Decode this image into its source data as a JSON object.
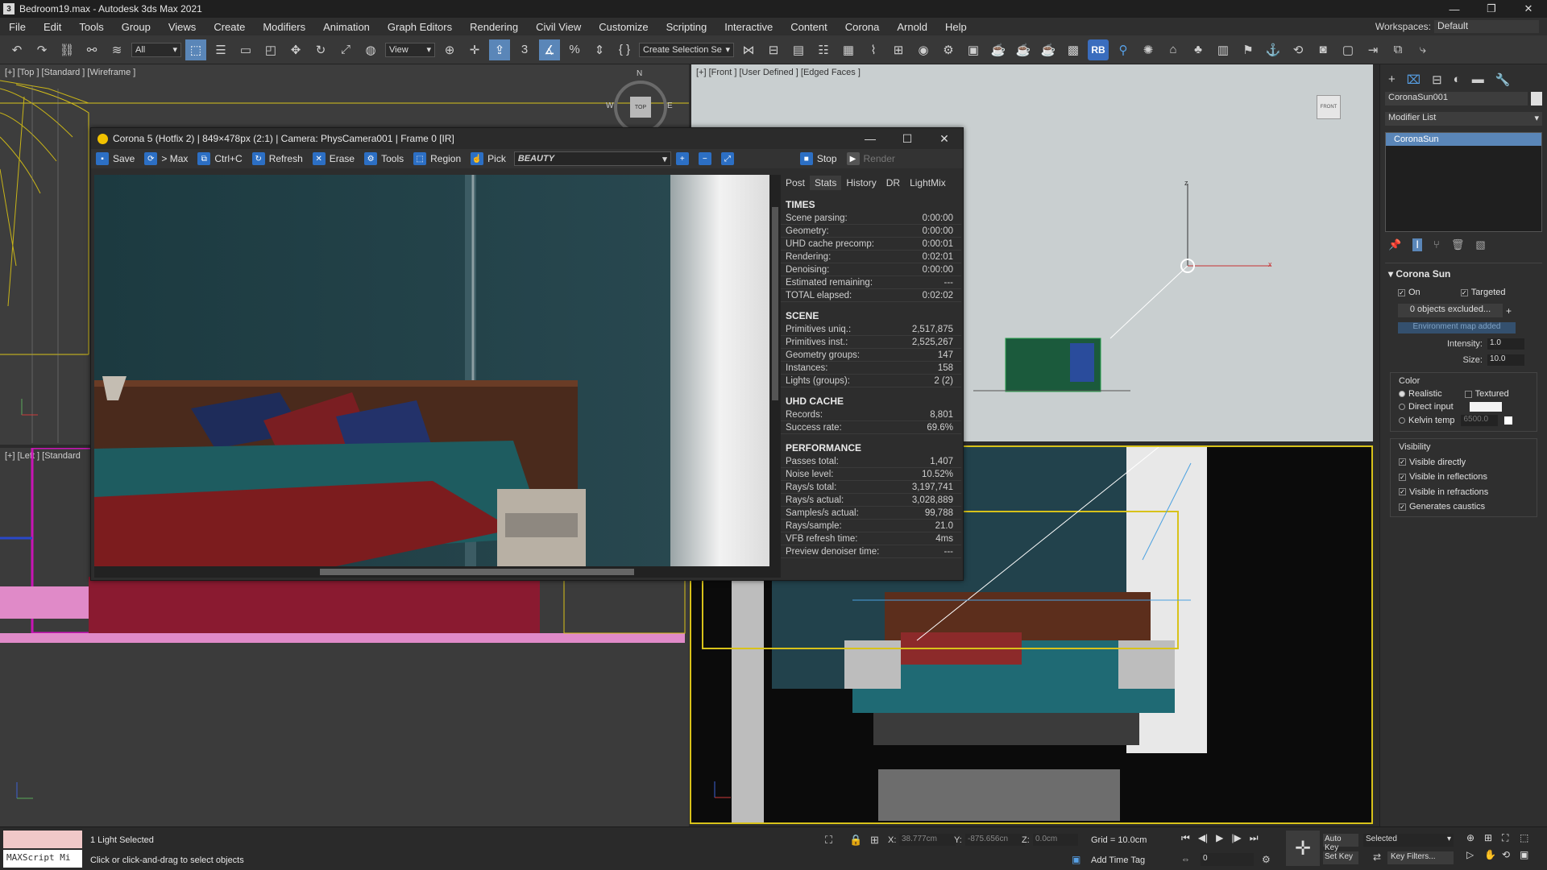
{
  "window": {
    "title": "Bedroom19.max - Autodesk 3ds Max 2021",
    "app_icon": "3",
    "min": "—",
    "max": "❐",
    "close": "✕"
  },
  "menu": {
    "items": [
      "File",
      "Edit",
      "Tools",
      "Group",
      "Views",
      "Create",
      "Modifiers",
      "Animation",
      "Graph Editors",
      "Rendering",
      "Civil View",
      "Customize",
      "Scripting",
      "Interactive",
      "Content",
      "Corona",
      "Arnold",
      "Help"
    ],
    "workspace_label": "Workspaces:",
    "workspace_value": "Default"
  },
  "toolbar": {
    "filter_value": "All",
    "refcoord_value": "View",
    "named_selection": "Create Selection Se",
    "rb_label": "RB"
  },
  "viewports": {
    "top": "[+] [Top ] [Standard ] [Wireframe ]",
    "front": "[+] [Front ] [User Defined ] [Edged Faces ]",
    "left": "[+] [Left ] [Standard",
    "front_cube": "FRONT",
    "top_cube": "TOP",
    "compass_n": "N",
    "compass_w": "W",
    "compass_e": "E",
    "axis_z": "z",
    "axis_x": "x"
  },
  "vfb": {
    "title": "Corona 5 (Hotfix 2) | 849×478px (2:1) | Camera: PhysCamera001 | Frame 0 [IR]",
    "buttons": {
      "save": "Save",
      "tomax": "> Max",
      "ctrlc": "Ctrl+C",
      "refresh": "Refresh",
      "erase": "Erase",
      "tools": "Tools",
      "region": "Region",
      "pick": "Pick",
      "stop": "Stop",
      "render": "Render"
    },
    "channel": "BEAUTY",
    "tabs": [
      "Post",
      "Stats",
      "History",
      "DR",
      "LightMix"
    ],
    "active_tab": "Stats",
    "stats": {
      "times_title": "TIMES",
      "times": [
        [
          "Scene parsing:",
          "0:00:00"
        ],
        [
          "Geometry:",
          "0:00:00"
        ],
        [
          "UHD cache precomp:",
          "0:00:01"
        ],
        [
          "Rendering:",
          "0:02:01"
        ],
        [
          "Denoising:",
          "0:00:00"
        ],
        [
          "Estimated remaining:",
          "---"
        ],
        [
          "TOTAL elapsed:",
          "0:02:02"
        ]
      ],
      "scene_title": "SCENE",
      "scene": [
        [
          "Primitives uniq.:",
          "2,517,875"
        ],
        [
          "Primitives inst.:",
          "2,525,267"
        ],
        [
          "Geometry groups:",
          "147"
        ],
        [
          "Instances:",
          "158"
        ],
        [
          "Lights (groups):",
          "2 (2)"
        ]
      ],
      "uhd_title": "UHD CACHE",
      "uhd": [
        [
          "Records:",
          "8,801"
        ],
        [
          "Success rate:",
          "69.6%"
        ]
      ],
      "perf_title": "PERFORMANCE",
      "perf": [
        [
          "Passes total:",
          "1,407"
        ],
        [
          "Noise level:",
          "10.52%"
        ],
        [
          "Rays/s total:",
          "3,197,741"
        ],
        [
          "Rays/s actual:",
          "3,028,889"
        ],
        [
          "Samples/s actual:",
          "99,788"
        ],
        [
          "Rays/sample:",
          "21.0"
        ],
        [
          "VFB refresh time:",
          "4ms"
        ],
        [
          "Preview denoiser time:",
          "---"
        ]
      ]
    }
  },
  "command_panel": {
    "object_name": "CoronaSun001",
    "modifier_list": "Modifier List",
    "stack_item": "CoronaSun",
    "rollout_title": "Corona Sun",
    "on": "On",
    "targeted": "Targeted",
    "excluded": "0 objects excluded...",
    "plus": "+",
    "env_map": "Environment map added",
    "intensity_label": "Intensity:",
    "intensity": "1.0",
    "size_label": "Size:",
    "size": "10.0",
    "color_group": "Color",
    "realistic": "Realistic",
    "textured": "Textured",
    "direct_input": "Direct input",
    "kelvin_temp": "Kelvin temp",
    "kelvin_value": "6500.0",
    "visibility_group": "Visibility",
    "vis": [
      "Visible directly",
      "Visible in reflections",
      "Visible in refractions",
      "Generates caustics"
    ]
  },
  "status": {
    "maxscript": "MAXScript Mi",
    "selected": "1 Light Selected",
    "prompt": "Click or click-and-drag to select objects",
    "x_label": "X:",
    "x_value": "38.777cm",
    "y_label": "Y:",
    "y_value": "-875.656cn",
    "z_label": "Z:",
    "z_value": "0.0cm",
    "grid": "Grid = 10.0cm",
    "add_time_tag": "Add Time Tag",
    "auto_key": "Auto Key",
    "set_key": "Set Key",
    "key_mode": "Selected",
    "key_filters": "Key Filters...",
    "frame": "0"
  },
  "colors": {
    "accent_blue": "#2c6fc4",
    "selection_yellow": "#e8d11a",
    "wall_teal": "#1f3a44",
    "magenta": "#c814b4"
  }
}
